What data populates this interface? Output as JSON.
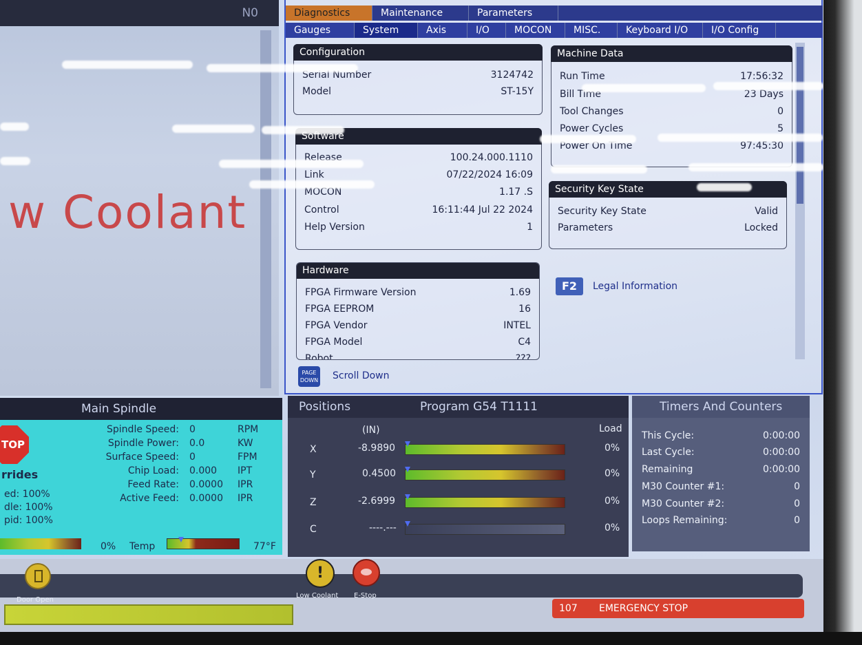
{
  "program_header": {
    "line_number": "N0"
  },
  "alarm_text": "w Coolant",
  "top_tabs": [
    {
      "label": "Diagnostics",
      "active": true
    },
    {
      "label": "Maintenance",
      "active": false
    },
    {
      "label": "Parameters",
      "active": false
    }
  ],
  "sub_tabs": [
    {
      "label": "Gauges",
      "active": false
    },
    {
      "label": "System",
      "active": true
    },
    {
      "label": "Axis",
      "active": false
    },
    {
      "label": "I/O",
      "active": false
    },
    {
      "label": "MOCON",
      "active": false
    },
    {
      "label": "MISC.",
      "active": false
    },
    {
      "label": "Keyboard I/O",
      "active": false
    },
    {
      "label": "I/O Config",
      "active": false
    }
  ],
  "configuration": {
    "title": "Configuration",
    "rows": [
      {
        "label": "Serial Number",
        "value": "3124742"
      },
      {
        "label": "Model",
        "value": "ST-15Y"
      }
    ]
  },
  "software": {
    "title": "Software",
    "rows": [
      {
        "label": "Release",
        "value": "100.24.000.1110"
      },
      {
        "label": "Link",
        "value": "07/22/2024 16:09"
      },
      {
        "label": "MOCON",
        "value": "1.17 .S"
      },
      {
        "label": "Control",
        "value": "16:11:44 Jul 22 2024"
      },
      {
        "label": "Help Version",
        "value": "1"
      }
    ]
  },
  "hardware": {
    "title": "Hardware",
    "rows": [
      {
        "label": "FPGA Firmware Version",
        "value": "1.69"
      },
      {
        "label": "FPGA EEPROM",
        "value": "16"
      },
      {
        "label": "FPGA Vendor",
        "value": "INTEL"
      },
      {
        "label": "FPGA Model",
        "value": "C4"
      },
      {
        "label": "Robot",
        "value": "???"
      }
    ]
  },
  "scroll_hint": {
    "key_top": "PAGE",
    "key_bottom": "DOWN",
    "label": "Scroll Down"
  },
  "machine_data": {
    "title": "Machine Data",
    "rows": [
      {
        "label": "Run Time",
        "value": "17:56:32"
      },
      {
        "label": "Bill Time",
        "value": "23 Days"
      },
      {
        "label": "Tool Changes",
        "value": "0"
      },
      {
        "label": "Power Cycles",
        "value": "5"
      },
      {
        "label": "Power On Time",
        "value": "97:45:30"
      }
    ]
  },
  "security": {
    "title": "Security Key State",
    "rows": [
      {
        "label": "Security Key State",
        "value": "Valid"
      },
      {
        "label": "Parameters",
        "value": "Locked"
      }
    ]
  },
  "legal": {
    "key": "F2",
    "label": "Legal Information"
  },
  "spindle": {
    "title": "Main Spindle",
    "stop_label": "TOP",
    "overrides_title": "rrides",
    "overrides": [
      {
        "label": "ed:",
        "value": "100%"
      },
      {
        "label": "dle:",
        "value": "100%"
      },
      {
        "label": "pid:",
        "value": "100%"
      }
    ],
    "rows": [
      {
        "label": "Spindle Speed:",
        "value": "0",
        "unit": "RPM"
      },
      {
        "label": "Spindle Power:",
        "value": "0.0",
        "unit": "KW"
      },
      {
        "label": "Surface Speed:",
        "value": "0",
        "unit": "FPM"
      },
      {
        "label": "Chip Load:",
        "value": "0.000",
        "unit": "IPT"
      },
      {
        "label": "Feed Rate:",
        "value": "0.0000",
        "unit": "IPR"
      },
      {
        "label": "Active Feed:",
        "value": "0.0000",
        "unit": "IPR"
      }
    ],
    "load_percent": "0%",
    "temp_label": "Temp",
    "temp_value": "77°F",
    "temp_level": 0.15
  },
  "positions": {
    "title": "Positions",
    "program": "Program G54 T1111",
    "units": "(IN)",
    "load_header": "Load",
    "axes": [
      {
        "axis": "X",
        "value": "-8.9890",
        "load": "0%",
        "active": true
      },
      {
        "axis": "Y",
        "value": "0.4500",
        "load": "0%",
        "active": true
      },
      {
        "axis": "Z",
        "value": "-2.6999",
        "load": "0%",
        "active": true
      },
      {
        "axis": "C",
        "value": "----.---",
        "load": "0%",
        "active": false
      }
    ]
  },
  "timers": {
    "title": "Timers And Counters",
    "rows": [
      {
        "label": "This Cycle:",
        "value": "0:00:00"
      },
      {
        "label": "Last Cycle:",
        "value": "0:00:00"
      },
      {
        "label": "Remaining",
        "value": "0:00:00"
      },
      {
        "label": "M30 Counter #1:",
        "value": "0"
      },
      {
        "label": "M30 Counter #2:",
        "value": "0"
      },
      {
        "label": "Loops Remaining:",
        "value": "0"
      }
    ]
  },
  "status_icons": [
    {
      "label": "Door Open"
    },
    {
      "label": "Low Coolant"
    },
    {
      "label": "E-Stop"
    }
  ],
  "alarm_bar": {
    "code": "107",
    "message": "EMERGENCY STOP"
  },
  "colors": {
    "accent": "#2c3a8c",
    "active_tab": "#c8742a",
    "alarm": "#d8402e",
    "spindle_bg": "#3ed4d8"
  }
}
